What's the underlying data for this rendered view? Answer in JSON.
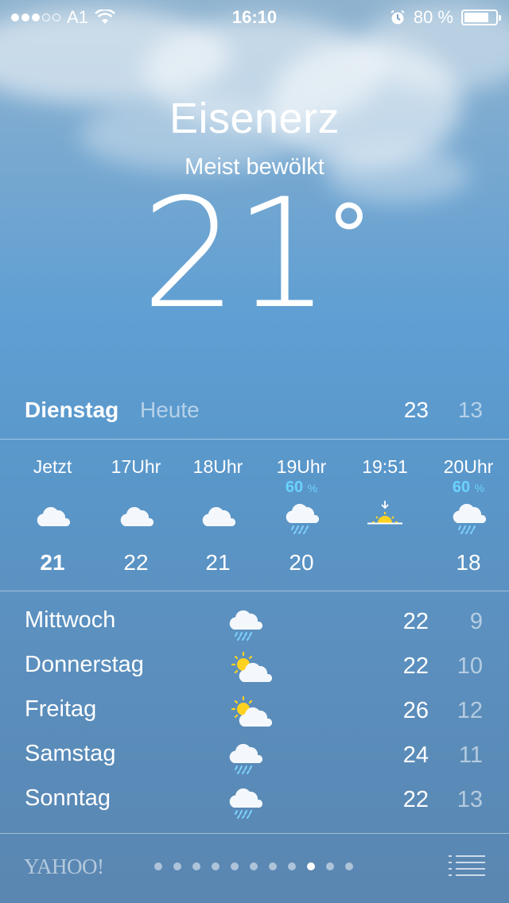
{
  "status": {
    "carrier": "A1",
    "time": "16:10",
    "battery": "80 %",
    "battery_level": 0.8,
    "signal_bars_filled": 3,
    "signal_bars_total": 5
  },
  "location": {
    "city": "Eisenerz",
    "condition": "Meist bewölkt",
    "temperature": "21",
    "degree": "°"
  },
  "today": {
    "day": "Dienstag",
    "label": "Heute",
    "high": "23",
    "low": "13"
  },
  "hourly": [
    {
      "time": "Jetzt",
      "pct": "",
      "icon": "cloud-icon",
      "temp": "21"
    },
    {
      "time": "17Uhr",
      "pct": "",
      "icon": "cloud-icon",
      "temp": "22"
    },
    {
      "time": "18Uhr",
      "pct": "",
      "icon": "cloud-icon",
      "temp": "21"
    },
    {
      "time": "19Uhr",
      "pct": "60",
      "icon": "rain-cloud-icon",
      "temp": "20"
    },
    {
      "time": "19:51",
      "pct": "",
      "icon": "sunset-icon",
      "temp": ""
    },
    {
      "time": "20Uhr",
      "pct": "60",
      "icon": "rain-cloud-icon",
      "temp": "18"
    }
  ],
  "pct_unit": "%",
  "daily": [
    {
      "day": "Mittwoch",
      "icon": "rain-cloud-icon",
      "high": "22",
      "low": "9"
    },
    {
      "day": "Donnerstag",
      "icon": "partly-sunny-icon",
      "high": "22",
      "low": "10"
    },
    {
      "day": "Freitag",
      "icon": "partly-sunny-icon",
      "high": "26",
      "low": "12"
    },
    {
      "day": "Samstag",
      "icon": "rain-cloud-icon",
      "high": "24",
      "low": "11"
    },
    {
      "day": "Sonntag",
      "icon": "rain-cloud-icon",
      "high": "22",
      "low": "13"
    }
  ],
  "footer": {
    "provider": "YAHOO!",
    "page_count": 11,
    "active_page": 9
  },
  "colors": {
    "precip": "#6bd2ff",
    "sun": "#ffd21f"
  }
}
